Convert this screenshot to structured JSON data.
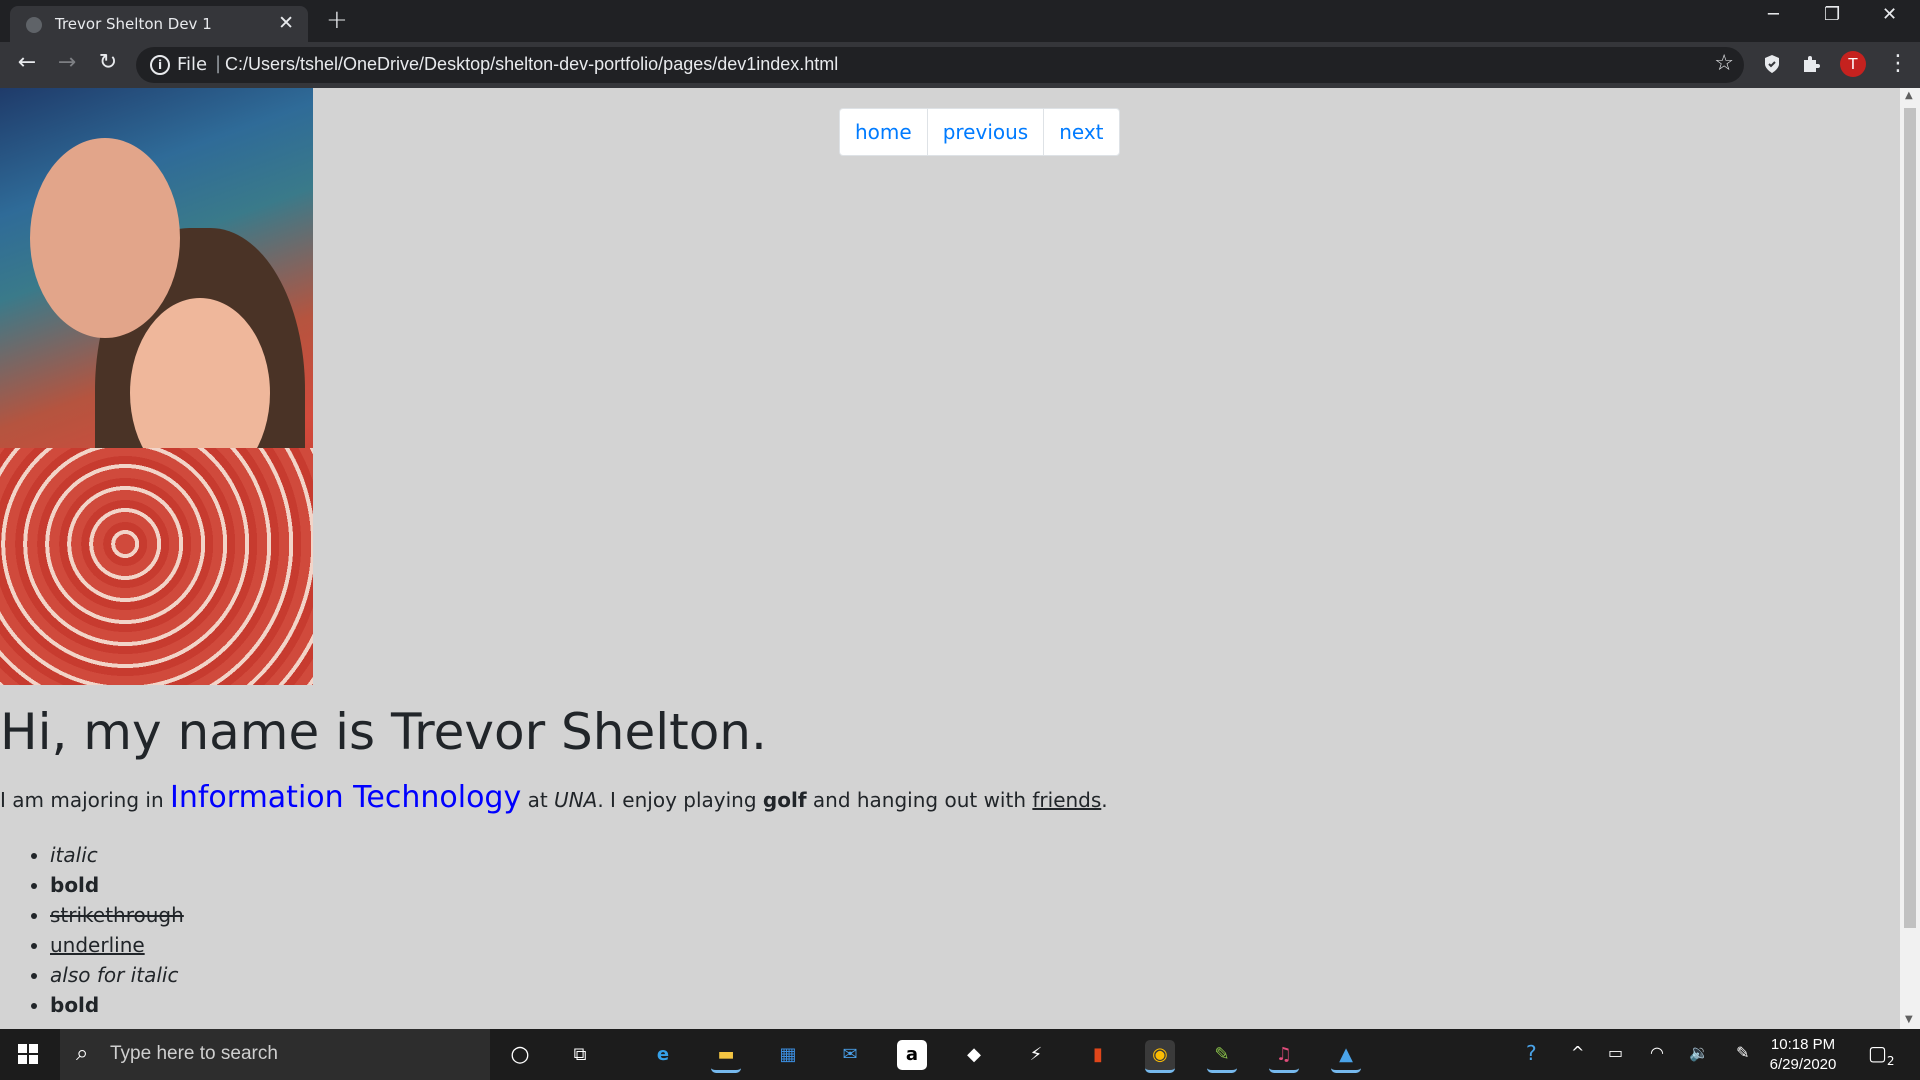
{
  "browser": {
    "tab_title": "Trevor Shelton Dev 1",
    "new_tab": "+",
    "close_tab": "✕",
    "minimize": "─",
    "restore": "❐",
    "close_window": "✕",
    "back": "←",
    "forward": "→",
    "reload": "↻",
    "info": "i",
    "scheme": "File",
    "separator": "|",
    "url": "C:/Users/tshel/OneDrive/Desktop/shelton-dev-portfolio/pages/dev1index.html",
    "bookmark_star": "☆",
    "profile_initial": "T",
    "menu": "⋮"
  },
  "page": {
    "nav": [
      "home",
      "previous",
      "next"
    ],
    "heading": "Hi, my name is Trevor Shelton.",
    "intro": {
      "t1": "I am majoring in ",
      "major": "Information Technology",
      "t2": " at ",
      "school": "UNA",
      "t3": ". I enjoy playing ",
      "hobby": "golf",
      "t4": " and hanging out with ",
      "friends": "friends",
      "t5": "."
    },
    "list": [
      "italic",
      "bold",
      "strikethrough",
      "underline",
      "also for italic",
      "bold"
    ]
  },
  "taskbar": {
    "search_placeholder": "Type here to search",
    "time": "10:18 PM",
    "date": "6/29/2020",
    "notification_count": "2"
  },
  "colors": {
    "page_bg": "#d3d3d3",
    "link_blue": "#007bff",
    "major_blue": "#0000ff",
    "avatar_red": "#c5221f"
  }
}
